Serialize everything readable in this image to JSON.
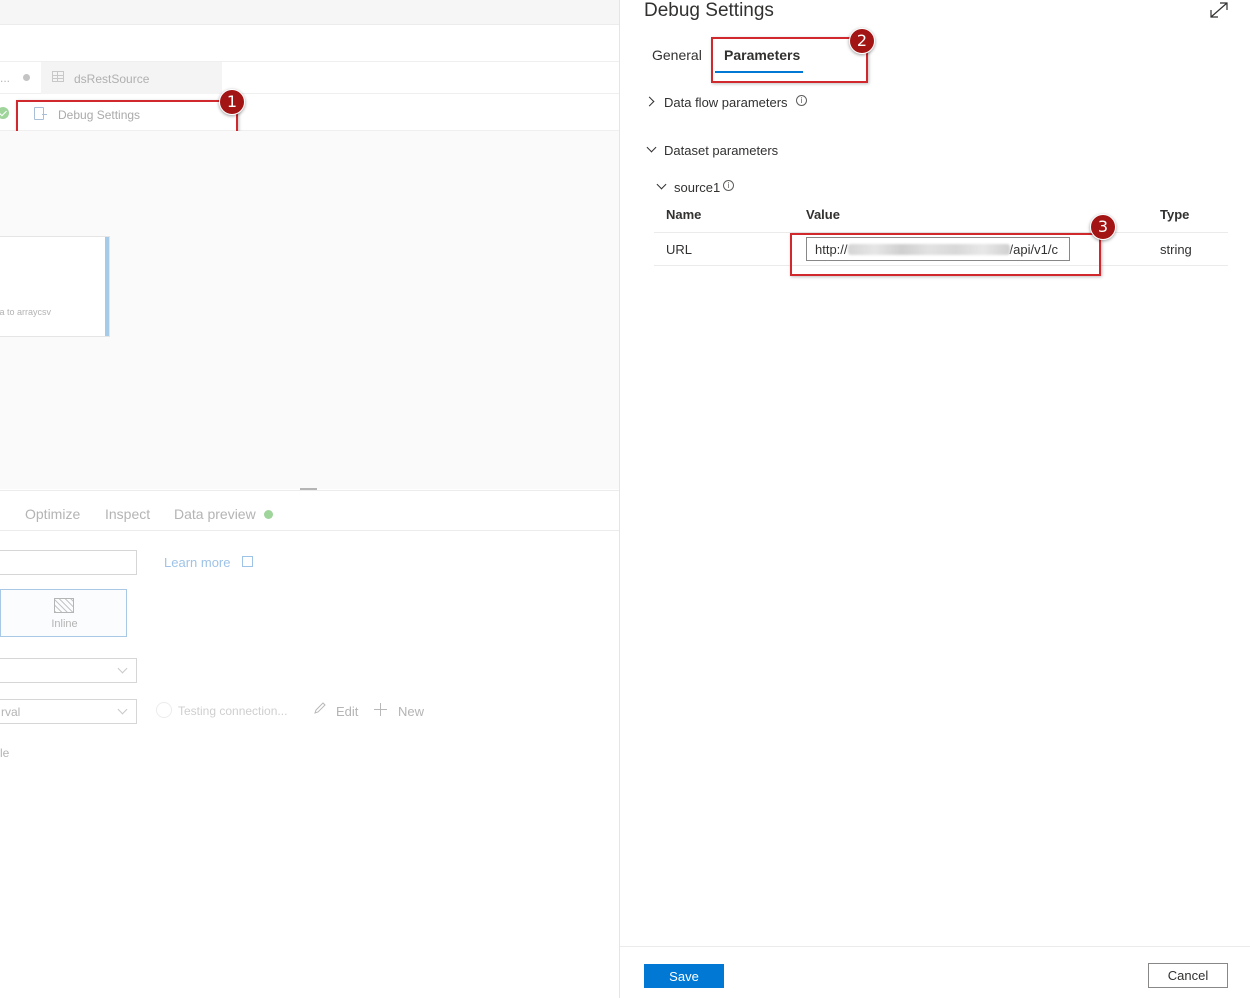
{
  "left": {
    "tab_ellipsis": "...",
    "dataset_tab_label": "dsRestSource",
    "debug_settings_label": "Debug Settings",
    "node_label": "ta to arraycsv",
    "bottom_tabs": [
      "Optimize",
      "Inspect",
      "Data preview"
    ],
    "learn_more": "Learn more",
    "inline_label": "Inline",
    "select_partial_value": "rval",
    "testing_connection": "Testing connection...",
    "edit_label": "Edit",
    "new_label": "New",
    "le_text": "le"
  },
  "callouts": [
    "1",
    "2",
    "3"
  ],
  "panel": {
    "title": "Debug Settings",
    "tabs": {
      "general": "General",
      "parameters": "Parameters"
    },
    "data_flow_parameters": "Data flow parameters",
    "dataset_parameters": "Dataset parameters",
    "source_name": "source1",
    "table": {
      "headers": {
        "name": "Name",
        "value": "Value",
        "type": "Type"
      },
      "rows": [
        {
          "name": "URL",
          "value_prefix": "http://",
          "value_suffix": "/api/v1/c",
          "type": "string"
        }
      ]
    },
    "save_label": "Save",
    "cancel_label": "Cancel"
  },
  "colors": {
    "accent": "#0078d4",
    "highlight_border": "#d0282d",
    "callout_fill": "#a31515",
    "status_green": "#9fd49b"
  },
  "icons": [
    "table-icon",
    "doc-icon",
    "check-icon",
    "external-link-icon",
    "hatch-icon",
    "pencil-icon",
    "plus-icon",
    "expand-icon",
    "info-icon",
    "chevron-right-icon",
    "chevron-down-icon"
  ]
}
